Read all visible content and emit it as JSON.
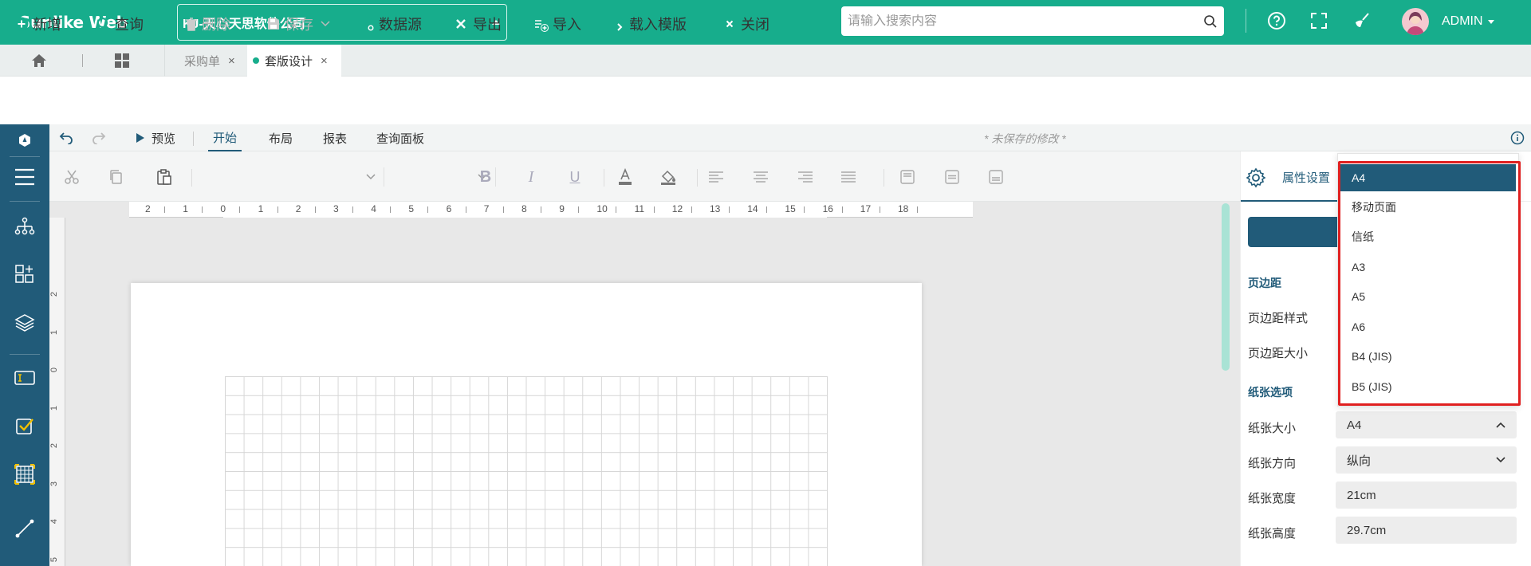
{
  "header": {
    "brand": "Sunlike Web",
    "company": "KJ-天心天思软件公司",
    "search_placeholder": "请输入搜索内容",
    "user": "ADMIN"
  },
  "tabs": [
    {
      "label": "采购单",
      "close": "×"
    },
    {
      "label": "套版设计",
      "close": "×"
    }
  ],
  "actions": {
    "add": "新增",
    "query": "查询",
    "delete": "删除",
    "save": "保存",
    "datasource": "数据源",
    "export": "导出",
    "import": "导入",
    "load_template": "载入模版",
    "close": "关闭"
  },
  "ribbon": {
    "preview": "预览",
    "tabs": [
      "开始",
      "布局",
      "报表",
      "查询面板"
    ],
    "unsaved": "* 未保存的修改 *"
  },
  "ruler": {
    "h": [
      "2",
      "1",
      "0",
      "1",
      "2",
      "3",
      "4",
      "5",
      "6",
      "7",
      "8",
      "9",
      "10",
      "11",
      "12",
      "13",
      "14",
      "15",
      "16",
      "17",
      "18"
    ],
    "v": [
      "2",
      "1",
      "0",
      "1",
      "2",
      "3",
      "4",
      "5"
    ]
  },
  "panel": {
    "title": "属性设置",
    "margin_section": "页边距",
    "margin_style": "页边距样式",
    "margin_size": "页边距大小",
    "paper_section": "纸张选项",
    "paper_size_label": "纸张大小",
    "paper_size_value": "A4",
    "orientation_label": "纸张方向",
    "orientation_value": "纵向",
    "width_label": "纸张宽度",
    "width_value": "21cm",
    "height_label": "纸张高度",
    "height_value": "29.7cm"
  },
  "dropdown": {
    "options": [
      "A4",
      "移动页面",
      "信纸",
      "A3",
      "A5",
      "A6",
      "B4 (JIS)",
      "B5 (JIS)"
    ],
    "selected": "A4"
  },
  "colors": {
    "brand_green": "#17ad8c",
    "nav_blue": "#215b79",
    "highlight_red": "#e02020"
  }
}
